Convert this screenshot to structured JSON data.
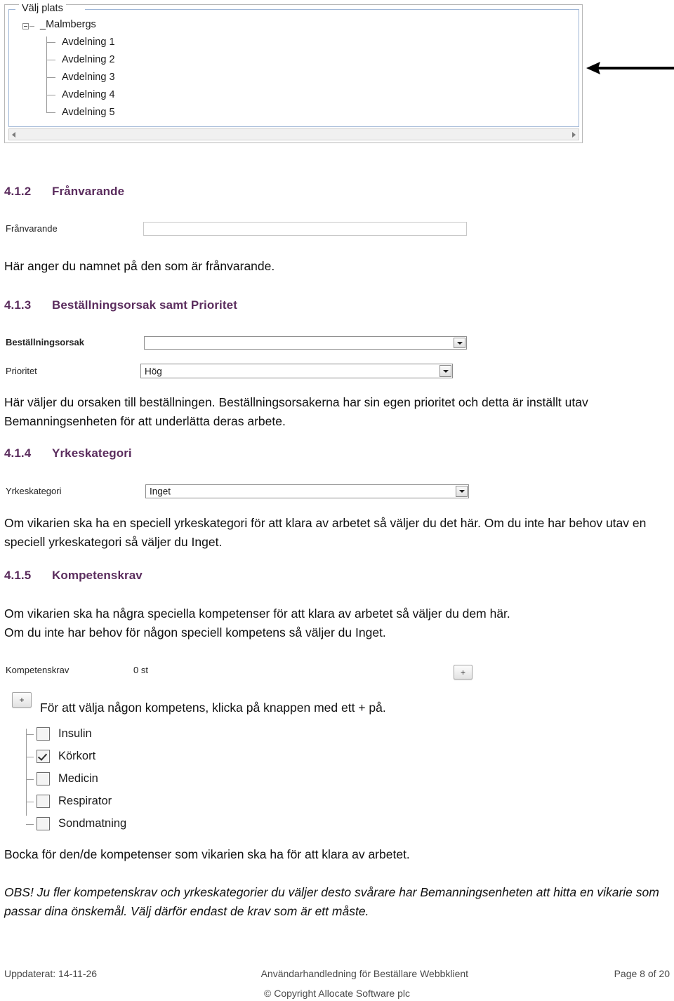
{
  "place_screenshot": {
    "groupbox_title": "Välj plats",
    "tree": {
      "root_label": "_Malmbergs",
      "children": [
        {
          "label": "Avdelning 1"
        },
        {
          "label": "Avdelning 2"
        },
        {
          "label": "Avdelning 3"
        },
        {
          "label": "Avdelning 4"
        },
        {
          "label": "Avdelning 5"
        }
      ]
    },
    "scrollbar": {
      "left_arrow": "◀",
      "right_arrow": "▶"
    }
  },
  "sections": {
    "s412": {
      "number": "4.1.2",
      "title": "Frånvarande",
      "field_label": "Frånvarande",
      "field_value": "",
      "body": "Här anger du namnet på den som är frånvarande."
    },
    "s413": {
      "number": "4.1.3",
      "title": "Beställningsorsak samt Prioritet",
      "orsak_label": "Beställningsorsak",
      "orsak_value": "",
      "prioritet_label": "Prioritet",
      "prioritet_value": "Hög",
      "body": "Här väljer du orsaken till beställningen. Beställningsorsakerna har sin egen prioritet och detta är inställt utav Bemanningsenheten för att underlätta deras arbete."
    },
    "s414": {
      "number": "4.1.4",
      "title": "Yrkeskategori",
      "field_label": "Yrkeskategori",
      "field_value": "Inget",
      "body": "Om vikarien ska ha en speciell yrkeskategori för att klara av arbetet så väljer du det här. Om du inte har behov utav en speciell yrkeskategori så väljer du Inget."
    },
    "s415": {
      "number": "4.1.5",
      "title": "Kompetenskrav",
      "body1": "Om vikarien ska ha några speciella kompetenser för att klara av arbetet så väljer du dem här.",
      "body2": "Om du inte har behov för någon speciell kompetens så väljer du Inget.",
      "field_label": "Kompetenskrav",
      "count_label": "0 st",
      "add_button_label": "+",
      "callout_button_label": "+",
      "callout_text": "För att välja någon kompetens, klicka på knappen med ett + på.",
      "competences": [
        {
          "label": "Insulin",
          "checked": false
        },
        {
          "label": "Körkort",
          "checked": true
        },
        {
          "label": "Medicin",
          "checked": false
        },
        {
          "label": "Respirator",
          "checked": false
        },
        {
          "label": "Sondmatning",
          "checked": false
        }
      ],
      "body3": "Bocka för den/de kompetenser som vikarien ska ha för att klara av arbetet.",
      "note": "OBS! Ju fler kompetenskrav och yrkeskategorier du väljer desto svårare har Bemanningsenheten att hitta en vikarie som passar dina önskemål. Välj därför endast de krav som är ett måste."
    }
  },
  "footer": {
    "updated": "Uppdaterat: 14-11-26",
    "center": "Användarhandledning för Beställare Webbklient",
    "page": "Page 8 of 20",
    "copyright": "© Copyright Allocate Software plc"
  },
  "colors": {
    "heading": "#5b2d5e",
    "body_text": "#111111",
    "footer_text": "#4a4a4a",
    "ui_border": "#8d8d8d"
  }
}
